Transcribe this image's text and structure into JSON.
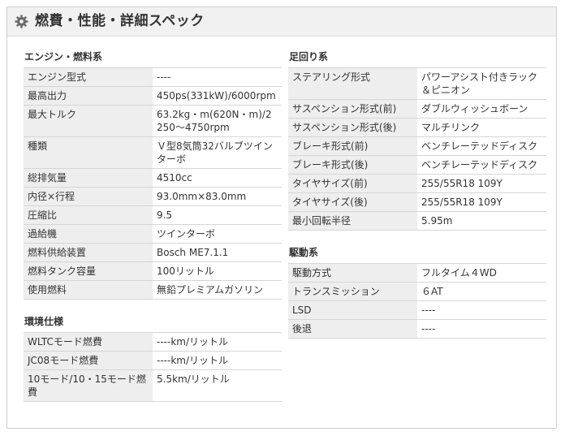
{
  "header": {
    "title": "燃費・性能・詳細スペック",
    "icon": "gear-icon"
  },
  "left_sections": [
    {
      "title": "エンジン・燃料系",
      "rows": [
        {
          "label": "エンジン型式",
          "value": "----"
        },
        {
          "label": "最高出力",
          "value": "450ps(331kW)/6000rpm"
        },
        {
          "label": "最大トルク",
          "value": "63.2kg・m(620N・m)/2250～4750rpm"
        },
        {
          "label": "種類",
          "value": "Ｖ型8気筒32バルブツインターボ"
        },
        {
          "label": "総排気量",
          "value": "4510cc"
        },
        {
          "label": "内径×行程",
          "value": "93.0mm×83.0mm"
        },
        {
          "label": "圧縮比",
          "value": "9.5"
        },
        {
          "label": "過給機",
          "value": "ツインターボ"
        },
        {
          "label": "燃料供給装置",
          "value": "Bosch ME7.1.1"
        },
        {
          "label": "燃料タンク容量",
          "value": "100リットル"
        },
        {
          "label": "使用燃料",
          "value": "無鉛プレミアムガソリン"
        }
      ]
    },
    {
      "title": "環境仕様",
      "rows": [
        {
          "label": "WLTCモード燃費",
          "value": "----km/リットル"
        },
        {
          "label": "JC08モード燃費",
          "value": "----km/リットル"
        },
        {
          "label": "10モード/10・15モード燃費",
          "value": "5.5km/リットル"
        }
      ]
    }
  ],
  "right_sections": [
    {
      "title": "足回り系",
      "rows": [
        {
          "label": "ステアリング形式",
          "value": "パワーアシスト付きラック＆ピニオン"
        },
        {
          "label": "サスペンション形式(前)",
          "value": "ダブルウィッシュボーン"
        },
        {
          "label": "サスペンション形式(後)",
          "value": "マルチリンク"
        },
        {
          "label": "ブレーキ形式(前)",
          "value": "ベンチレーテッドディスク"
        },
        {
          "label": "ブレーキ形式(後)",
          "value": "ベンチレーテッドディスク"
        },
        {
          "label": "タイヤサイズ(前)",
          "value": "255/55R18 109Y"
        },
        {
          "label": "タイヤサイズ(後)",
          "value": "255/55R18 109Y"
        },
        {
          "label": "最小回転半径",
          "value": "5.95m"
        }
      ]
    },
    {
      "title": "駆動系",
      "rows": [
        {
          "label": "駆動方式",
          "value": "フルタイム４WD"
        },
        {
          "label": "トランスミッション",
          "value": "６AT"
        },
        {
          "label": "LSD",
          "value": "----"
        },
        {
          "label": "後退",
          "value": "----"
        }
      ]
    }
  ]
}
